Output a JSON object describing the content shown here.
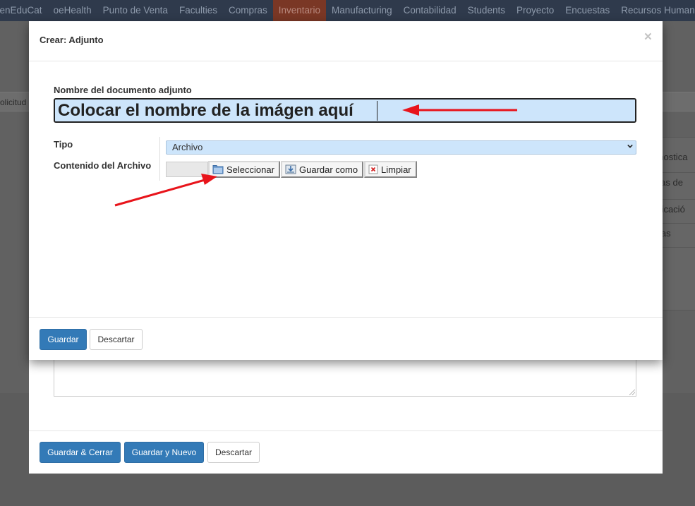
{
  "topnav": {
    "items": [
      {
        "label": "penEduCat",
        "active": false
      },
      {
        "label": "oeHealth",
        "active": false
      },
      {
        "label": "Punto de Venta",
        "active": false
      },
      {
        "label": "Faculties",
        "active": false
      },
      {
        "label": "Compras",
        "active": false
      },
      {
        "label": "Inventario",
        "active": true
      },
      {
        "label": "Manufacturing",
        "active": false
      },
      {
        "label": "Contabilidad",
        "active": false
      },
      {
        "label": "Students",
        "active": false
      },
      {
        "label": "Proyecto",
        "active": false
      },
      {
        "label": "Encuestas",
        "active": false
      },
      {
        "label": "Recursos Humanos",
        "active": false
      }
    ]
  },
  "background": {
    "left_text": "olicitud",
    "side_items": [
      "onostica",
      "glas de",
      "bricació",
      "ntas",
      "as"
    ]
  },
  "back_modal": {
    "footer": {
      "save_close": "Guardar & Cerrar",
      "save_new": "Guardar y Nuevo",
      "discard": "Descartar"
    }
  },
  "dialog": {
    "title": "Crear: Adjunto",
    "close_symbol": "×",
    "name_label": "Nombre del documento adjunto",
    "name_value": "Colocar el nombre de la imágen aquí",
    "type_label": "Tipo",
    "type_value": "Archivo",
    "content_label": "Contenido del Archivo",
    "file_buttons": {
      "select": "Seleccionar",
      "save_as": "Guardar como",
      "clear": "Limpiar"
    },
    "footer": {
      "save": "Guardar",
      "discard": "Descartar"
    }
  },
  "colors": {
    "accent": "#337ab7",
    "arrow": "#e8141b",
    "input_highlight": "#cde5fb",
    "nav_active": "#7a3725"
  }
}
